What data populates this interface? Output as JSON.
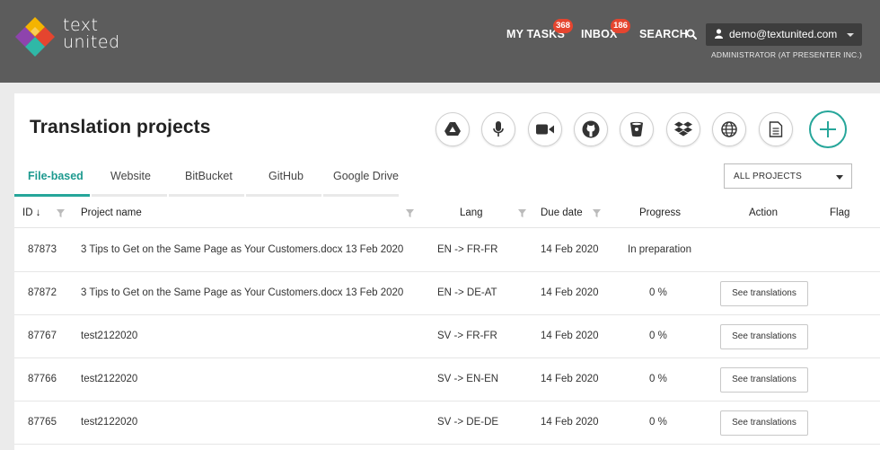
{
  "header": {
    "logo_line1": "text",
    "logo_line2": "united",
    "my_tasks_label": "MY TASKS",
    "my_tasks_count": "368",
    "inbox_label": "INBOX",
    "inbox_count": "186",
    "search_label": "SEARCH",
    "user_email": "demo@textunited.com",
    "user_role": "ADMINISTRATOR (AT PRESENTER INC.)"
  },
  "page": {
    "title": "Translation projects",
    "source_icons": [
      "google-drive-icon",
      "microphone-icon",
      "video-camera-icon",
      "github-icon",
      "bitbucket-icon",
      "dropbox-icon",
      "globe-icon",
      "document-icon",
      "plus-icon"
    ]
  },
  "tabs": [
    {
      "label": "File-based",
      "active": true
    },
    {
      "label": "Website",
      "active": false
    },
    {
      "label": "BitBucket",
      "active": false
    },
    {
      "label": "GitHub",
      "active": false
    },
    {
      "label": "Google Drive",
      "active": false
    }
  ],
  "filter_select": {
    "value": "ALL PROJECTS"
  },
  "table": {
    "columns": {
      "id": "ID ↓",
      "name": "Project name",
      "lang": "Lang",
      "due": "Due date",
      "progress": "Progress",
      "action": "Action",
      "flag": "Flag"
    },
    "rows": [
      {
        "id": "87873",
        "name": "3 Tips to Get on the Same Page as Your Customers.docx 13 Feb 2020",
        "lang": "EN -> FR-FR",
        "due": "14 Feb 2020",
        "progress": "In preparation",
        "action": ""
      },
      {
        "id": "87872",
        "name": "3 Tips to Get on the Same Page as Your Customers.docx 13 Feb 2020",
        "lang": "EN -> DE-AT",
        "due": "14 Feb 2020",
        "progress": "0 %",
        "action": "See translations"
      },
      {
        "id": "87767",
        "name": "test2122020",
        "lang": "SV -> FR-FR",
        "due": "14 Feb 2020",
        "progress": "0 %",
        "action": "See translations"
      },
      {
        "id": "87766",
        "name": "test2122020",
        "lang": "SV -> EN-EN",
        "due": "14 Feb 2020",
        "progress": "0 %",
        "action": "See translations"
      },
      {
        "id": "87765",
        "name": "test2122020",
        "lang": "SV -> DE-DE",
        "due": "14 Feb 2020",
        "progress": "0 %",
        "action": "See translations"
      }
    ]
  },
  "colors": {
    "header_bg": "#5c5c5c",
    "accent_teal": "#26a69a",
    "badge_red": "#e5452f"
  }
}
